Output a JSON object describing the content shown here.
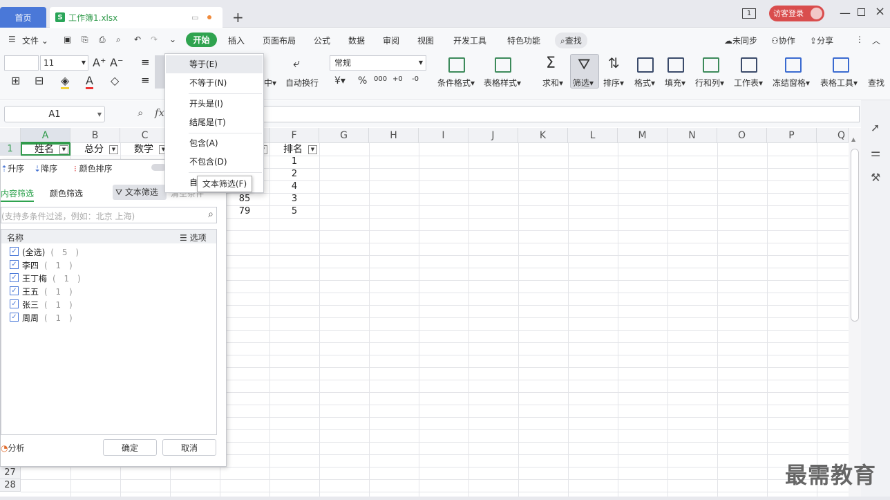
{
  "titlebar": {
    "home_tab": "首页",
    "file_tab": "工作簿1.xlsx",
    "page_num": "1",
    "login": "访客登录"
  },
  "menu": {
    "file": "文件",
    "start": "开始",
    "items": [
      "插入",
      "页面布局",
      "公式",
      "数据",
      "审阅",
      "视图",
      "开发工具",
      "特色功能"
    ],
    "search": "查找",
    "sync": "未同步",
    "collab": "协作",
    "share": "分享"
  },
  "ribbon": {
    "font_size": "11",
    "wrap": "自动换行",
    "center": "中",
    "number_format": "常规",
    "currency": "¥",
    "percent": "%",
    "thousands": "000",
    "dec_inc": "+0",
    "dec_dec": "-0",
    "groups": [
      "条件格式",
      "表格样式",
      "求和",
      "筛选",
      "排序",
      "格式",
      "填充",
      "行和列",
      "工作表",
      "冻结窗格",
      "表格工具",
      "查找"
    ]
  },
  "formula": {
    "cell_ref": "A1",
    "fx": "fx"
  },
  "sheet": {
    "columns": [
      "A",
      "B",
      "C",
      "D",
      "E",
      "F",
      "G",
      "H",
      "I",
      "J",
      "K",
      "L",
      "M",
      "N",
      "O",
      "P",
      "Q"
    ],
    "header_row": [
      "姓名",
      "总分",
      "数学",
      "",
      "",
      "排名"
    ],
    "row_nums": [
      "1",
      "27",
      "28"
    ],
    "col_e_values": [
      "85",
      "79"
    ],
    "col_f_values": [
      "1",
      "2",
      "4",
      "3",
      "5"
    ]
  },
  "filter_panel": {
    "asc": "升序",
    "desc": "降序",
    "color_sort": "颜色排序",
    "content_tab": "内容筛选",
    "color_tab": "颜色筛选",
    "text_filter": "文本筛选",
    "clear": "清空条件",
    "search_placeholder": "(支持多条件过滤，例如：北京 上海)",
    "list_header": "名称",
    "options": "选项",
    "items": [
      {
        "name": "(全选)",
        "count": "( 5 )"
      },
      {
        "name": "李四",
        "count": "( 1 )"
      },
      {
        "name": "王丁梅",
        "count": "( 1 )"
      },
      {
        "name": "王五",
        "count": "( 1 )"
      },
      {
        "name": "张三",
        "count": "( 1 )"
      },
      {
        "name": "周周",
        "count": "( 1 )"
      }
    ],
    "analysis": "分析",
    "ok": "确定",
    "cancel": "取消"
  },
  "dropdown": {
    "items": [
      "等于(E)",
      "不等于(N)",
      "开头是(I)",
      "结尾是(T)",
      "包含(A)",
      "不包含(D)",
      "自"
    ],
    "tooltip": "文本筛选(F)"
  },
  "watermark": "最需教育",
  "colors": {
    "accent_blue": "#4a78d8",
    "accent_green": "#2fa34f",
    "login_red": "#d94d4d"
  }
}
